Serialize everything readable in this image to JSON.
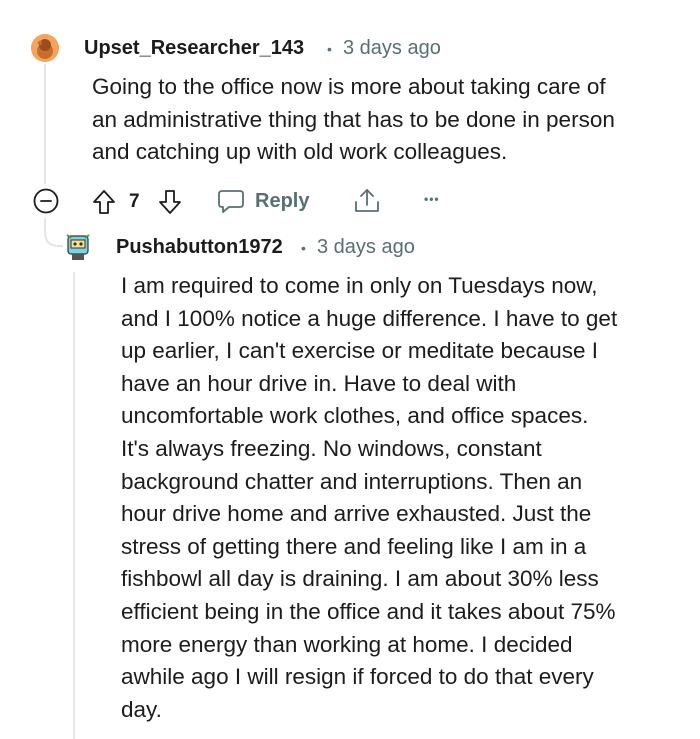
{
  "comments": [
    {
      "author": "Upset_Researcher_143",
      "separator": "•",
      "time": "3 days ago",
      "body": "Going to the office now is more about taking care of\nan administrative thing that has to be done in person\nand catching up with old work colleagues.",
      "votes": "7",
      "reply_label": "Reply",
      "more_label": "•••"
    },
    {
      "author": "Pushabutton1972",
      "separator": "•",
      "time": "3 days ago",
      "body": "I am required to come in only on Tuesdays now,\nand I 100% notice a huge difference. I have to get\nup earlier, I can't exercise or meditate because I\nhave an hour drive in. Have to deal with\nuncomfortable work clothes, and office spaces.\nIt's always freezing. No windows, constant\nbackground chatter and interruptions. Then an\nhour drive home and arrive exhausted. Just the\nstress of getting there and feeling like I am in a\nfishbowl all day is draining. I am about 30% less\nefficient being in the office and it takes about 75%\nmore energy than working at home. I decided\nawhile ago I will resign if forced to do that every\nday."
    }
  ],
  "icons": {
    "collapse": "minus-circle-icon",
    "upvote": "arrow-up-icon",
    "downvote": "arrow-down-icon",
    "reply": "speech-bubble-icon",
    "share": "share-icon",
    "more": "ellipsis-icon"
  },
  "colors": {
    "text": "#1c1c1c",
    "muted": "#576f76",
    "thread_line": "#e3e6e8",
    "avatar1_bg": "#f5a45d"
  }
}
